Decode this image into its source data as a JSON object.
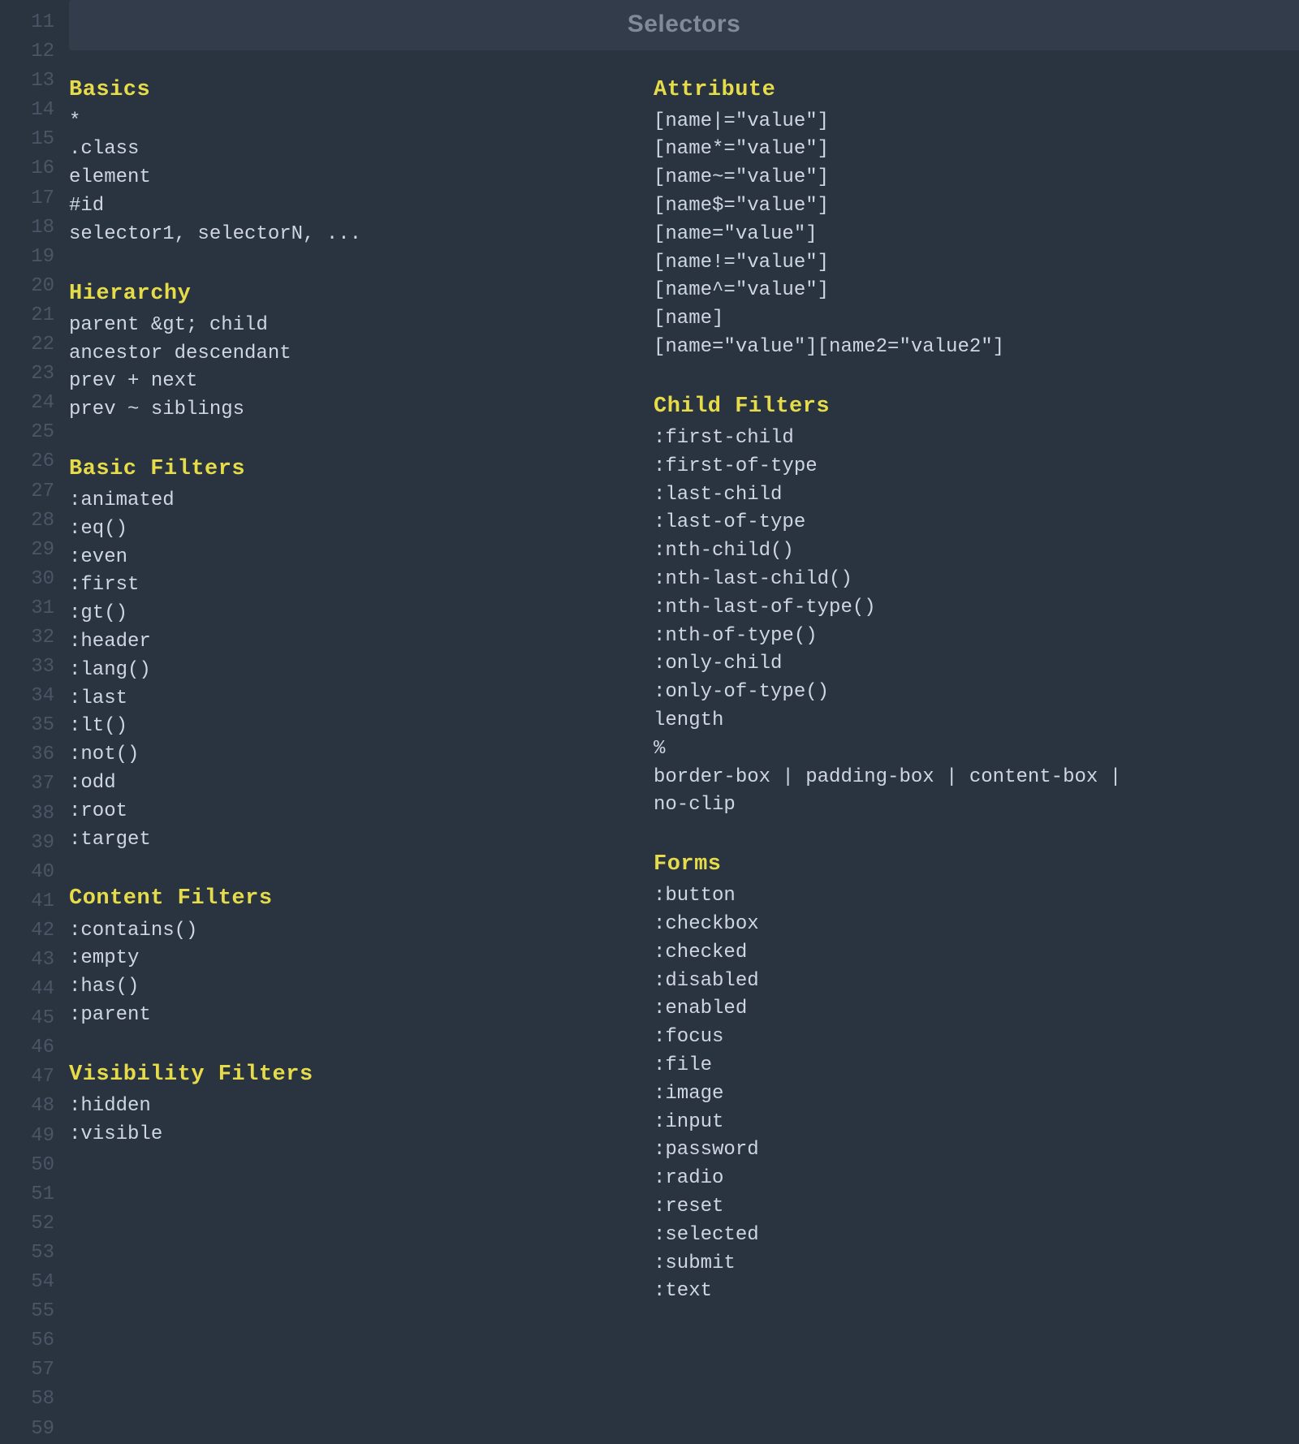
{
  "gutter": {
    "start": 11,
    "end": 59
  },
  "title": "Selectors",
  "columns": [
    {
      "sections": [
        {
          "heading": "Basics",
          "items": [
            "*",
            ".class",
            "element",
            "#id",
            "selector1, selectorN, ..."
          ]
        },
        {
          "heading": "Hierarchy",
          "items": [
            "parent &gt; child",
            "ancestor descendant",
            "prev + next",
            "prev ~ siblings"
          ]
        },
        {
          "heading": "Basic Filters",
          "items": [
            ":animated",
            ":eq()",
            ":even",
            ":first",
            ":gt()",
            ":header",
            ":lang()",
            ":last",
            ":lt()",
            ":not()",
            ":odd",
            ":root",
            ":target"
          ]
        },
        {
          "heading": "Content Filters",
          "items": [
            ":contains()",
            ":empty",
            ":has()",
            ":parent"
          ]
        },
        {
          "heading": "Visibility Filters",
          "items": [
            ":hidden",
            ":visible"
          ]
        }
      ]
    },
    {
      "sections": [
        {
          "heading": "Attribute",
          "items": [
            "[name|=\"value\"]",
            "[name*=\"value\"]",
            "[name~=\"value\"]",
            "[name$=\"value\"]",
            "[name=\"value\"]",
            "[name!=\"value\"]",
            "[name^=\"value\"]",
            "[name]",
            "[name=\"value\"][name2=\"value2\"]"
          ]
        },
        {
          "heading": "Child Filters",
          "items": [
            ":first-child",
            ":first-of-type",
            ":last-child",
            ":last-of-type",
            ":nth-child()",
            ":nth-last-child()",
            ":nth-last-of-type()",
            ":nth-of-type()",
            ":only-child",
            ":only-of-type()",
            "length",
            "%",
            "border-box | padding-box | content-box |",
            "no-clip"
          ]
        },
        {
          "heading": "Forms",
          "items": [
            ":button",
            ":checkbox",
            ":checked",
            ":disabled",
            ":enabled",
            ":focus",
            ":file",
            ":image",
            ":input",
            ":password",
            ":radio",
            ":reset",
            ":selected",
            ":submit",
            ":text"
          ]
        }
      ]
    }
  ]
}
